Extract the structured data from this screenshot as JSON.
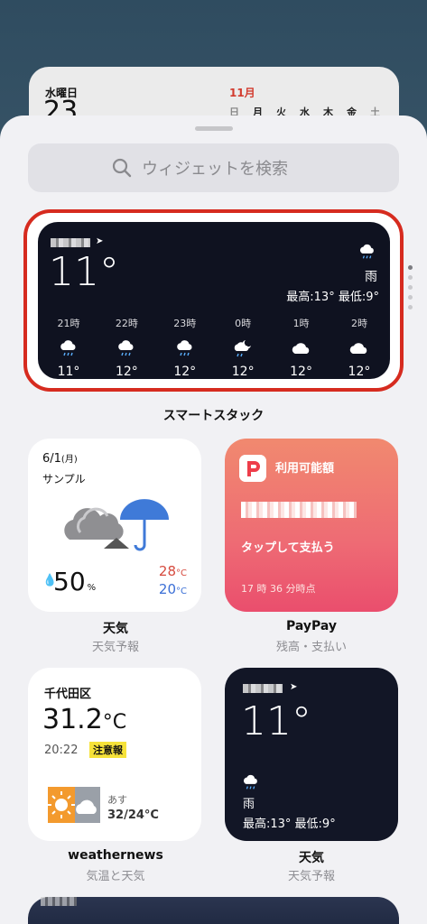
{
  "background_calendar": {
    "day_label": "水曜日",
    "date": "23",
    "month": "11月",
    "weekdays": [
      "日",
      "月",
      "火",
      "水",
      "木",
      "金",
      "土"
    ]
  },
  "search": {
    "placeholder": "ウィジェットを検索"
  },
  "smart_stack": {
    "temperature": "11°",
    "condition": "雨",
    "hi_lo": "最高:13° 最低:9°",
    "hours": [
      {
        "time": "21時",
        "icon": "rain-icon",
        "temp": "11°"
      },
      {
        "time": "22時",
        "icon": "rain-icon",
        "temp": "12°"
      },
      {
        "time": "23時",
        "icon": "rain-icon",
        "temp": "12°"
      },
      {
        "time": "0時",
        "icon": "moon-cloud-rain-icon",
        "temp": "12°"
      },
      {
        "time": "1時",
        "icon": "cloud-icon",
        "temp": "12°"
      },
      {
        "time": "2時",
        "icon": "cloud-icon",
        "temp": "12°"
      }
    ],
    "label": "スマートスタック"
  },
  "widgets": {
    "tenki": {
      "date": "6/1",
      "weekday": "(月)",
      "sample": "サンプル",
      "precip": "50",
      "precip_unit": "%",
      "high": "28",
      "low": "20",
      "unit": "°C",
      "name": "天気",
      "subtitle": "天気予報"
    },
    "paypay": {
      "title": "利用可能額",
      "pay_label": "タップして支払う",
      "time": "17 時 36 分時点",
      "name": "PayPay",
      "subtitle": "残高・支払い"
    },
    "weathernews": {
      "location": "千代田区",
      "temperature": "31.2",
      "temp_unit": "°C",
      "time": "20:22",
      "alert": "注意報",
      "tomorrow": "あす",
      "range": "32/24°C",
      "name": "weathernews",
      "subtitle": "気温と天気"
    },
    "tenki_small": {
      "temperature": "11°",
      "condition": "雨",
      "hi_lo": "最高:13° 最低:9°",
      "name": "天気",
      "subtitle": "天気予報"
    }
  },
  "colors": {
    "stack_border": "#d62b1f",
    "paypay_gradient_top": "#f1896f",
    "paypay_gradient_bottom": "#ea4e6d",
    "alert_badge": "#f6e23a"
  }
}
